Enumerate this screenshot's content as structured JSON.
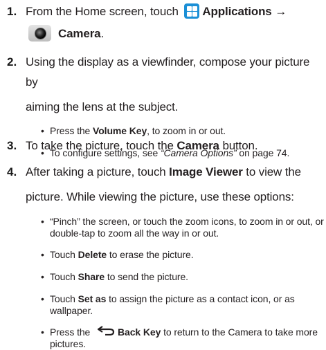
{
  "steps": [
    {
      "number": "1.",
      "line1_prefix": "From the Home screen, touch",
      "apps_label": "Applications →",
      "camera_label": "Camera",
      "camera_suffix": "."
    },
    {
      "number": "2.",
      "line1": "Using the display as a viewfinder, compose your picture by",
      "line2": "aiming the lens at the subject.",
      "bullets": [
        {
          "pre": "Press the ",
          "bold": "Volume Key",
          "post": ", to zoom in or out."
        },
        {
          "pre": "To configure settings, see ",
          "italic": "“Camera Options”",
          "post": " on page 74."
        }
      ]
    },
    {
      "number": "3.",
      "pre": "To take the picture, touch the ",
      "bold": "Camera",
      "post": " button."
    },
    {
      "number": "4.",
      "line1_pre": "After taking a picture, touch ",
      "line1_bold": "Image Viewer",
      "line1_post": " to view the",
      "line2": "picture. While viewing the picture, use these options:",
      "bullets": [
        {
          "line1": "“Pinch” the screen, or touch the zoom icons, to zoom in or out, or",
          "line2": "double-tap to zoom all the way in or out."
        },
        {
          "pre": "Touch ",
          "bold": "Delete",
          "post": "  to erase the picture."
        },
        {
          "pre": "Touch ",
          "bold": "Share",
          "post": "  to send the picture."
        },
        {
          "pre": "Touch ",
          "bold": "Set as",
          "post": "  to assign the picture as a contact icon, or as",
          "line2": "wallpaper."
        },
        {
          "pre": "Press the ",
          "bold": "Back Key",
          "post": " to return to the Camera to take more",
          "line2": "pictures."
        }
      ]
    }
  ],
  "icons": {
    "apps": "applications-grid-icon",
    "camera": "camera-icon",
    "back": "back-arrow-icon"
  },
  "colors": {
    "apps_icon": "#1b8fd6",
    "text": "#231f20"
  }
}
